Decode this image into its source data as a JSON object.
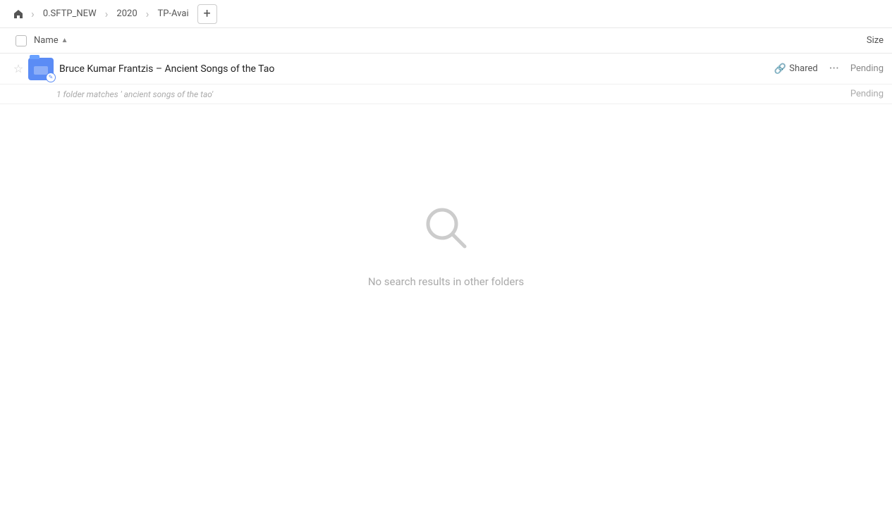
{
  "breadcrumb": {
    "home_icon": "⌂",
    "sep1": "›",
    "item1": "0.SFTP_NEW",
    "sep2": "›",
    "item2": "2020",
    "sep3": "›",
    "item3": "TP-Avai",
    "add_icon": "+"
  },
  "column_header": {
    "name_label": "Name",
    "sort_icon": "▲",
    "size_label": "Size"
  },
  "file_row": {
    "star_icon": "☆",
    "folder_edit_icon": "✎",
    "name": "Bruce Kumar Frantzis – Ancient Songs of the Tao",
    "shared_label": "Shared",
    "more_icon": "···",
    "pending_label": "Pending"
  },
  "match_info": {
    "text": "1 folder matches ' ancient songs of the tao'",
    "pending_label": "Pending"
  },
  "empty_state": {
    "icon": "🔍",
    "text": "No search results in other folders"
  }
}
